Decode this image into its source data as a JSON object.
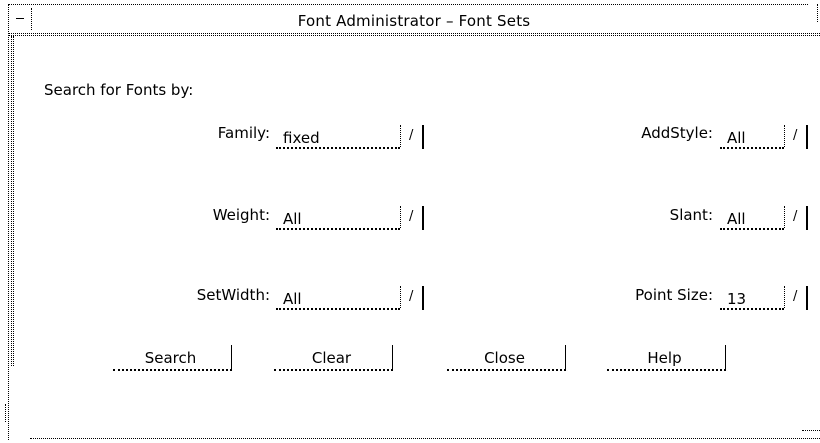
{
  "window": {
    "title": "Font Administrator – Font Sets"
  },
  "search": {
    "heading": "Search for Fonts by:"
  },
  "fields": {
    "family": {
      "label": "Family:",
      "value": "fixed"
    },
    "weight": {
      "label": "Weight:",
      "value": "All"
    },
    "setwidth": {
      "label": "SetWidth:",
      "value": "All"
    },
    "addstyle": {
      "label": "AddStyle:",
      "value": "All"
    },
    "slant": {
      "label": "Slant:",
      "value": "All"
    },
    "pointsize": {
      "label": "Point Size:",
      "value": "13"
    }
  },
  "choice_mark": "/",
  "buttons": {
    "search": "Search",
    "clear": "Clear",
    "close": "Close",
    "help": "Help"
  }
}
